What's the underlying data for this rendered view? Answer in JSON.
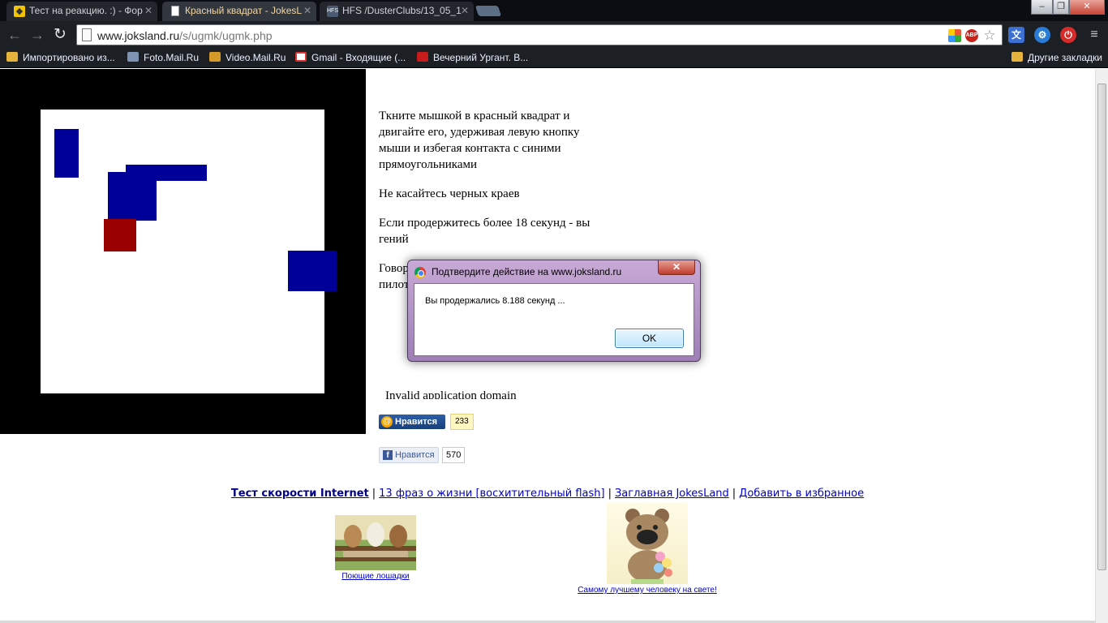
{
  "browser": {
    "tabs": [
      {
        "title": "Тест на реакцию. :) - Фор",
        "active": false,
        "icon": "renault-icon"
      },
      {
        "title": "Красный квадрат - JokesL",
        "active": true,
        "icon": "page-icon"
      },
      {
        "title": "HFS /DusterClubs/13_05_1",
        "active": false,
        "icon": "hfs-icon"
      }
    ],
    "window_buttons": {
      "minimize": "–",
      "maximize": "❐",
      "close": "✕"
    },
    "url_host": "www.joksland.ru",
    "url_path": "/s/ugmk/ugmk.php",
    "bookmarks": [
      {
        "label": "Импортировано из...",
        "icon": "folder-icon"
      },
      {
        "label": "Foto.Mail.Ru",
        "icon": "camera-icon"
      },
      {
        "label": "Video.Mail.Ru",
        "icon": "video-icon"
      },
      {
        "label": "Gmail - Входящие (...",
        "icon": "gmail-icon"
      },
      {
        "label": "Вечерний Ургант. В...",
        "icon": "youtube-icon"
      }
    ],
    "other_bookmarks": "Другие закладки"
  },
  "page": {
    "instructions": [
      "Ткните мышкой в красный квадрат и двигайте его, удерживая левую кнопку мыши и избегая контакта с синими прямоугольниками",
      "Не касайтесь черных краев",
      "Если продержитесь более 18 секунд - вы гений",
      "Говорят, что этот тест проходят летчики-пилоты"
    ],
    "invalid_domain": "Invalid application domain",
    "mail_like": {
      "label": "Нравится",
      "count": "233"
    },
    "fb_like": {
      "label": "Нравится",
      "count": "570"
    },
    "footer_links": [
      {
        "label": "Тест скорости Internet",
        "bold": true
      },
      {
        "label": "13 фраз о жизни [восхитительный flash]",
        "bold": false
      },
      {
        "label": "Заглавная JokesLand",
        "bold": false
      },
      {
        "label": "Добавить в избранное",
        "bold": false
      }
    ],
    "footer_separator": "|",
    "promo_horses": "Поющие лошадки",
    "promo_bear": "Самому лучшему человеку на свете!"
  },
  "dialog": {
    "title": "Подтвердите действие на www.joksland.ru",
    "message": "Вы продержались 8.188 секунд ...",
    "ok_label": "OK",
    "close_label": "✕"
  },
  "colors": {
    "game_blue": "#000099",
    "game_red": "#990000",
    "link": "#0000cc"
  }
}
